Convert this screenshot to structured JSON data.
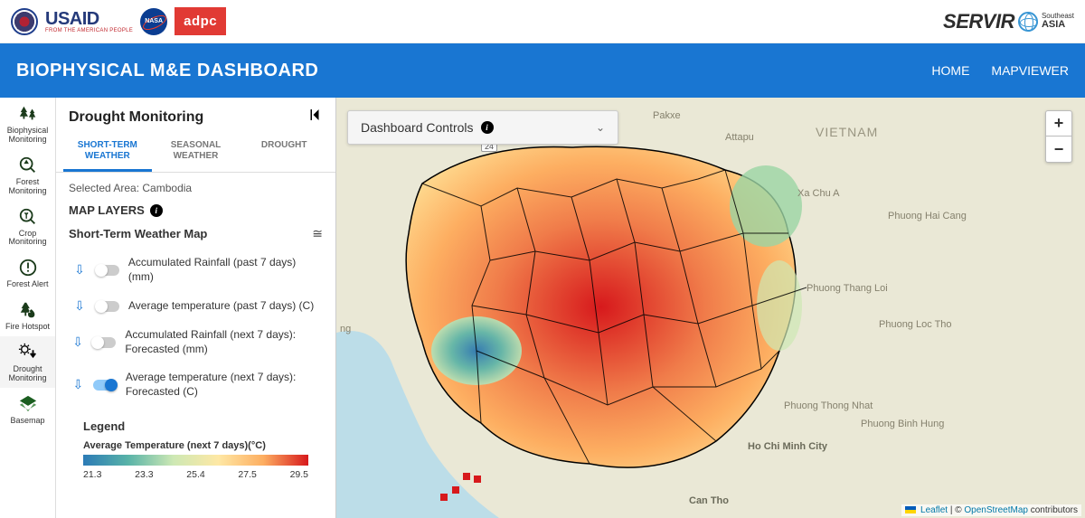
{
  "topbar": {
    "usaid": {
      "main": "USAID",
      "tagline": "FROM THE AMERICAN PEOPLE"
    },
    "nasa": "NASA",
    "adpc": "adpc",
    "servir": {
      "main": "SERVIR",
      "sub1": "Southeast",
      "sub2": "ASIA"
    }
  },
  "bluebar": {
    "title": "BIOPHYSICAL M&E DASHBOARD",
    "nav": {
      "home": "HOME",
      "mapviewer": "MAPVIEWER"
    }
  },
  "left_nav": [
    {
      "id": "biophysical",
      "label": "Biophysical Monitoring"
    },
    {
      "id": "forest-mon",
      "label": "Forest Monitoring"
    },
    {
      "id": "crop-mon",
      "label": "Crop Monitoring"
    },
    {
      "id": "forest-alert",
      "label": "Forest Alert"
    },
    {
      "id": "fire-hotspot",
      "label": "Fire Hotspot"
    },
    {
      "id": "drought-mon",
      "label": "Drought Monitoring"
    },
    {
      "id": "basemap",
      "label": "Basemap"
    }
  ],
  "panel": {
    "title": "Drought Monitoring",
    "tabs": {
      "shortterm": "SHORT-TERM WEATHER",
      "seasonal": "SEASONAL WEATHER",
      "drought": "DROUGHT"
    },
    "selected_area": "Selected Area: Cambodia",
    "map_layers_title": "MAP LAYERS",
    "subsection": "Short-Term Weather Map",
    "layers": [
      {
        "label": "Accumulated Rainfall (past 7 days) (mm)",
        "on": false
      },
      {
        "label": "Average temperature (past 7 days) (C)",
        "on": false
      },
      {
        "label": "Accumulated Rainfall (next 7 days): Forecasted (mm)",
        "on": false
      },
      {
        "label": "Average temperature (next 7 days): Forecasted (C)",
        "on": true
      }
    ],
    "legend": {
      "title": "Legend",
      "subtitle": "Average Temperature (next 7 days)(°C)",
      "ticks": [
        "21.3",
        "23.3",
        "25.4",
        "27.5",
        "29.5"
      ]
    }
  },
  "map": {
    "dashboard_controls": "Dashboard Controls",
    "zoom_in": "+",
    "zoom_out": "−",
    "attribution": {
      "leaflet": "Leaflet",
      "sep": " | © ",
      "osm": "OpenStreetMap",
      "tail": " contributors"
    },
    "places": {
      "vietnam": "VIETNAM",
      "pakxe": "Pakxe",
      "attapu": "Attapu",
      "xachua": "Xa Chu A",
      "phuong_haicang": "Phuong Hai Cang",
      "phuong_thangloi": "Phuong Thang Loi",
      "phuong_loctho": "Phuong Loc Tho",
      "phuong_thongnhat": "Phuong Thong Nhat",
      "phuong_binhhung": "Phuong Binh Hung",
      "hcmc": "Ho Chi Minh City",
      "cantho": "Can Tho",
      "bangkok_edge": "ng"
    },
    "road": "24"
  },
  "chart_data": {
    "type": "heatmap",
    "title": "Average Temperature (next 7 days)(°C)",
    "region": "Cambodia",
    "unit": "°C",
    "value_range": [
      21.3,
      29.5
    ],
    "colorbar_ticks": [
      21.3,
      23.3,
      25.4,
      27.5,
      29.5
    ],
    "colormap": "RdYlBu_r",
    "description": "Forecasted 7-day average temperature choropleth over Cambodian provinces; highest values (~29°C, red) over central/southern lowlands, cooler (~21-24°C, blue-green) over southwest Cardamom range and northeast highlands."
  }
}
